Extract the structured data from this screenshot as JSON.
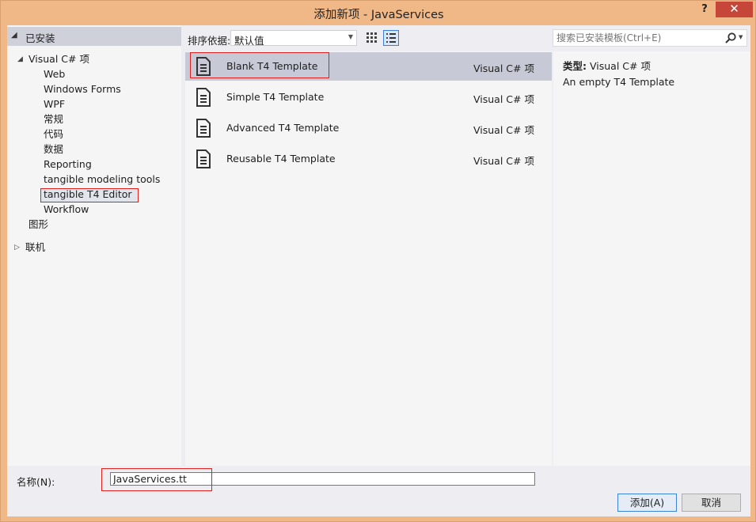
{
  "window": {
    "title": "添加新项 - JavaServices",
    "help_label": "?",
    "close_label": "✕"
  },
  "tree": {
    "installed_label": "已安装",
    "visual_csharp": "Visual C# 项",
    "children": [
      "Web",
      "Windows Forms",
      "WPF",
      "常规",
      "代码",
      "数据",
      "Reporting",
      "tangible modeling tools",
      "tangible T4 Editor",
      "Workflow"
    ],
    "graphics": "图形",
    "online": "联机"
  },
  "toolbar": {
    "sort_label": "排序依据:",
    "sort_value": "默认值"
  },
  "templates": [
    {
      "name": "Blank T4 Template",
      "type": "Visual C# 项"
    },
    {
      "name": "Simple T4 Template",
      "type": "Visual C# 项"
    },
    {
      "name": "Advanced T4 Template",
      "type": "Visual C# 项"
    },
    {
      "name": "Reusable T4 Template",
      "type": "Visual C# 项"
    }
  ],
  "search": {
    "placeholder": "搜索已安装模板(Ctrl+E)"
  },
  "details": {
    "type_key": "类型:",
    "type_value": "Visual C# 项",
    "description": "An empty T4 Template"
  },
  "footer": {
    "name_label": "名称(N):",
    "name_value": "JavaServices.tt",
    "add_label": "添加(A)",
    "cancel_label": "取消"
  },
  "colors": {
    "frame": "#f0b887",
    "close": "#c7463a",
    "highlight": "#e0201c",
    "accent": "#3c85d6"
  }
}
